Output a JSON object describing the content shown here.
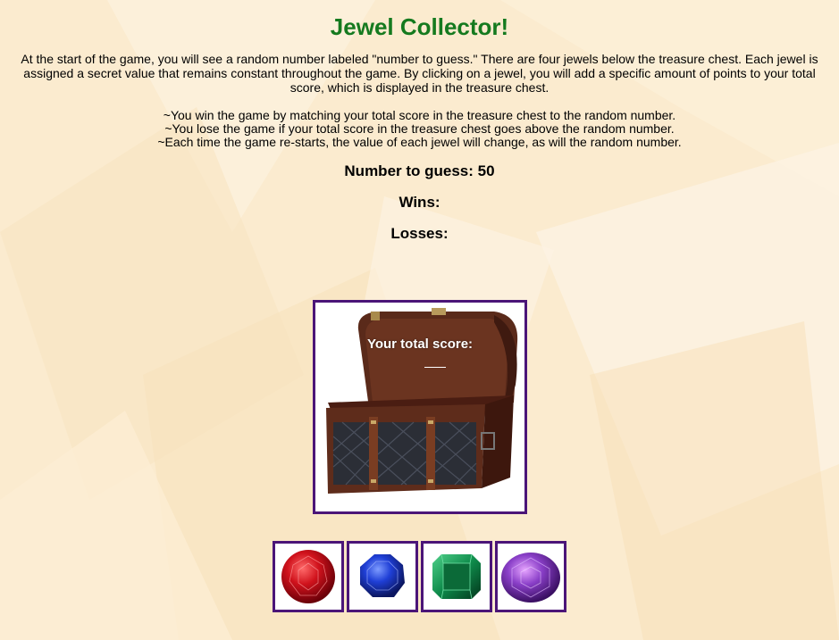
{
  "title": "Jewel Collector!",
  "intro": "At the start of the game, you will see a random number labeled \"number to guess.\" There are four jewels below the treasure chest. Each jewel is assigned a secret value that remains constant throughout the game. By clicking on a jewel, you will add a specific amount of points to your total score, which is displayed in the treasure chest.",
  "rules": [
    "~You win the game by matching your total score in the treasure chest to the random number.",
    "~You lose the game if your total score in the treasure chest goes above the random number.",
    "~Each time the game re-starts, the value of each jewel will change, as will the random number."
  ],
  "stats": {
    "target_label": "Number to guess:",
    "target_value": "50",
    "wins_label": "Wins:",
    "wins_value": "",
    "losses_label": "Losses:",
    "losses_value": ""
  },
  "chest": {
    "score_label": "Your total score:",
    "score_value": ""
  },
  "jewels": [
    {
      "name": "ruby",
      "color": "#d0121c"
    },
    {
      "name": "sapphire",
      "color": "#1f3fd6"
    },
    {
      "name": "emerald",
      "color": "#0e8a4a"
    },
    {
      "name": "amethyst",
      "color": "#8a3fc8"
    }
  ],
  "colors": {
    "title": "#157a1f",
    "frame": "#4b1578",
    "background": "#fbeacd"
  }
}
